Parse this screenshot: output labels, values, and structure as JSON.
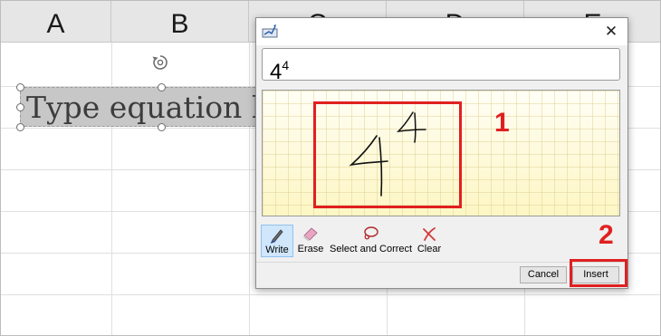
{
  "spreadsheet": {
    "columns": [
      "A",
      "B",
      "C",
      "D",
      "E"
    ]
  },
  "equation": {
    "placeholder_text": "Type equation here."
  },
  "dialog": {
    "preview": {
      "base": "4",
      "exponent": "4"
    },
    "tools": [
      {
        "label": "Write",
        "icon": "pen-icon",
        "active": true
      },
      {
        "label": "Erase",
        "icon": "eraser-icon",
        "active": false
      },
      {
        "label": "Select and Correct",
        "icon": "lasso-icon",
        "active": false
      },
      {
        "label": "Clear",
        "icon": "clear-icon",
        "active": false
      }
    ],
    "buttons": {
      "cancel": "Cancel",
      "insert": "Insert"
    }
  },
  "annotations": {
    "marker_1": "1",
    "marker_2": "2",
    "color": "#e02020"
  }
}
